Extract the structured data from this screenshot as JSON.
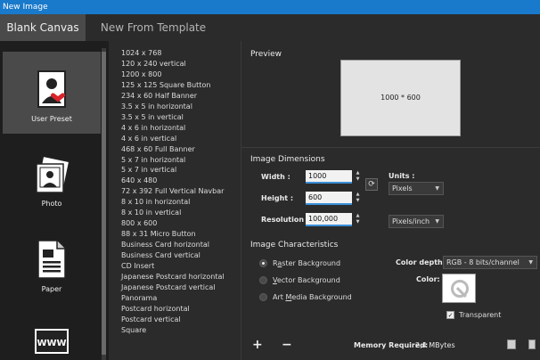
{
  "window": {
    "title": "New Image"
  },
  "tabs": [
    {
      "label": "Blank Canvas"
    },
    {
      "label": "New From Template"
    }
  ],
  "sidebar": {
    "items": [
      {
        "label": "User Preset",
        "icon": "user-preset-icon"
      },
      {
        "label": "Photo",
        "icon": "photo-icon"
      },
      {
        "label": "Paper",
        "icon": "paper-icon"
      },
      {
        "label": "",
        "icon": "www-icon",
        "badge": "WWW"
      }
    ]
  },
  "presets": [
    "1024 x 768",
    "120 x 240 vertical",
    "1200 x 800",
    "125 x 125 Square Button",
    "234 x 60 Half Banner",
    "3.5 x 5 in horizontal",
    "3.5 x 5 in vertical",
    "4 x 6 in horizontal",
    "4 x 6 in vertical",
    "468 x 60 Full Banner",
    "5 x 7 in horizontal",
    "5 x 7 in vertical",
    "640 x 480",
    "72 x 392 Full Vertical Navbar",
    "8 x 10 in horizontal",
    "8 x 10 in vertical",
    "800 x 600",
    "88 x 31 Micro Button",
    "Business Card horizontal",
    "Business Card vertical",
    "CD Insert",
    "Japanese Postcard horizontal",
    "Japanese Postcard vertical",
    "Panorama",
    "Postcard horizontal",
    "Postcard vertical",
    "Square"
  ],
  "preview": {
    "title": "Preview",
    "label": "1000 * 600"
  },
  "dimensions": {
    "title": "Image Dimensions",
    "width_label": "Width :",
    "width_value": "1000",
    "height_label": "Height :",
    "height_value": "600",
    "resolution_label": "Resolution :",
    "resolution_value": "100,000",
    "units_label": "Units :",
    "units_value": "Pixels",
    "res_units_value": "Pixels/inch"
  },
  "characteristics": {
    "title": "Image Characteristics",
    "raster_pre": "R",
    "raster_u": "a",
    "raster_post": "ster Background",
    "vector_pre": "",
    "vector_u": "V",
    "vector_post": "ector Background",
    "art_pre": "Art ",
    "art_u": "M",
    "art_post": "edia Background",
    "color_depth_label": "Color depth :",
    "color_depth_value": "RGB - 8 bits/channel",
    "color_label": "Color:",
    "transparent_label": "Transparent"
  },
  "footer": {
    "add": "+",
    "remove": "−",
    "memory_label": "Memory Required:",
    "memory_value": "2,4 MBytes"
  }
}
